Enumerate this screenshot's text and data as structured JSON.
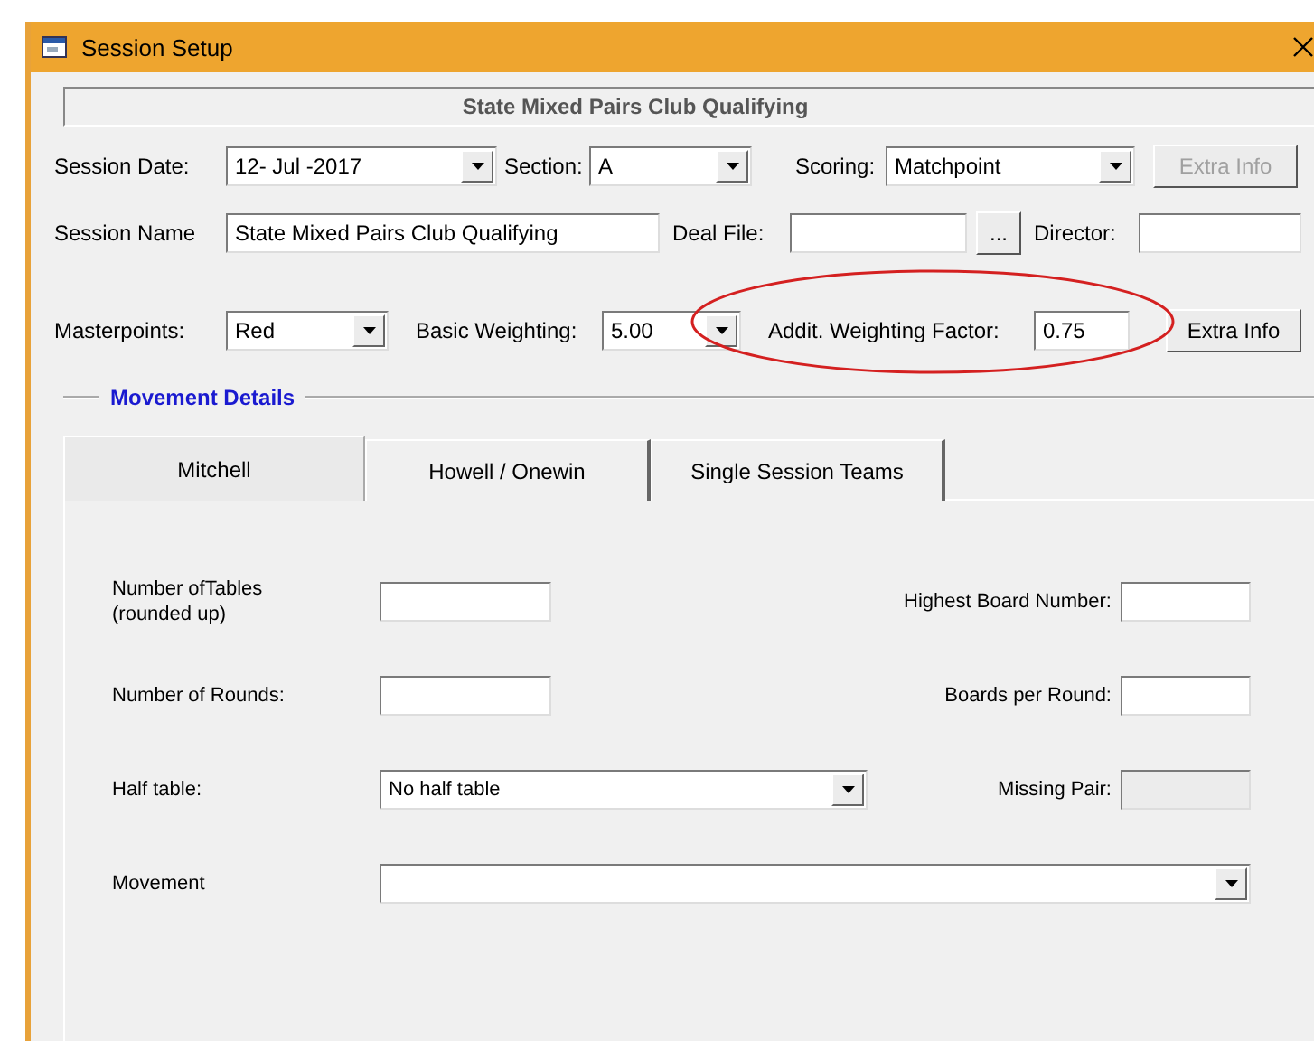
{
  "window": {
    "title": "Session Setup"
  },
  "header": {
    "title": "State Mixed Pairs Club Qualifying"
  },
  "rows": [
    [
      {
        "kind": "label",
        "text": "Session Date:"
      },
      {
        "kind": "combo",
        "value": "12- Jul -2017"
      },
      {
        "kind": "label",
        "text": "Section:"
      },
      {
        "kind": "combo",
        "value": "A"
      },
      {
        "kind": "label",
        "text": "Scoring:"
      },
      {
        "kind": "combo",
        "value": "Matchpoint"
      },
      {
        "kind": "button",
        "text": "Extra Info",
        "disabled": true
      }
    ],
    [
      {
        "kind": "label",
        "text": "Session Name"
      },
      {
        "kind": "input",
        "value": "State Mixed Pairs Club Qualifying",
        "disabled": false
      },
      {
        "kind": "label",
        "text": "Deal File:"
      },
      {
        "kind": "input",
        "disabled": false
      },
      {
        "kind": "browse",
        "text": "..."
      },
      {
        "kind": "label",
        "text": "Director:"
      },
      {
        "kind": "input",
        "disabled": false
      }
    ],
    [
      {
        "kind": "label",
        "text": "Masterpoints:"
      },
      {
        "kind": "combo",
        "value": "Red"
      },
      {
        "kind": "label",
        "text": "Basic Weighting:"
      },
      {
        "kind": "combo",
        "value": "5.00"
      },
      {
        "kind": "label",
        "text": "Addit. Weighting Factor:"
      },
      {
        "kind": "input",
        "value": "0.75",
        "disabled": false
      },
      {
        "kind": "button",
        "text": "Extra Info",
        "disabled": false
      }
    ]
  ],
  "movement": {
    "title": "Movement Details",
    "tabs": [
      {
        "label": "Mitchell",
        "selected": true
      },
      {
        "label": "Howell / Onewin",
        "selected": false
      },
      {
        "label": "Single Session Teams",
        "selected": false
      }
    ],
    "rows": [
      [
        {
          "kind": "label",
          "text": "Number ofTables (rounded up)"
        },
        {
          "kind": "input",
          "disabled": false
        },
        {
          "kind": "label",
          "text": "Highest Board Number:"
        },
        {
          "kind": "input",
          "disabled": false
        }
      ],
      [
        {
          "kind": "label",
          "text": "Number of Rounds:"
        },
        {
          "kind": "input",
          "disabled": false
        },
        {
          "kind": "label",
          "text": "Boards per Round:"
        },
        {
          "kind": "input",
          "disabled": false
        }
      ],
      [
        {
          "kind": "label",
          "text": "Half table:"
        },
        {
          "kind": "combo",
          "value": "No half table"
        },
        {
          "kind": "label",
          "text": "Missing Pair:"
        },
        {
          "kind": "input",
          "disabled": true
        }
      ],
      [
        {
          "kind": "label",
          "text": "Movement"
        },
        {
          "kind": "combo"
        }
      ]
    ]
  }
}
